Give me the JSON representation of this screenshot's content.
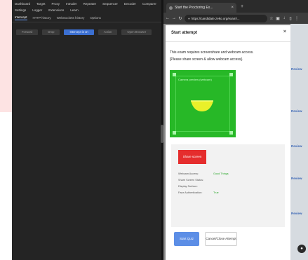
{
  "devtools": {
    "menu": [
      "Dashboard",
      "Target",
      "Proxy",
      "Intruder",
      "Repeater",
      "Sequencer",
      "Decoder",
      "Comparer",
      "Settings",
      "Logger",
      "Extensions",
      "Learn"
    ],
    "tabs": [
      "Intercept",
      "HTTP history",
      "WebSockets history",
      "Options"
    ],
    "toolbar": [
      "Forward",
      "Drop",
      "Intercept is on",
      "Action",
      "Open Browser"
    ],
    "active_tab": 0,
    "active_toolbar": 2
  },
  "browser": {
    "tab_title": "Start the Proctoring Ex...",
    "url": "https://candidate.zeko.org/exam/...",
    "side_links": [
      "Review",
      "Review",
      "Review",
      "Review",
      "Review"
    ]
  },
  "modal": {
    "title": "Start attempt",
    "close_icon": "×",
    "message_line1": "This exam requires screenshare and webcam access.",
    "message_line2": "[Please share screen & allow webcam access].",
    "camera_label": "Camera preview (webcam)",
    "share_button": "Share screen",
    "info": [
      {
        "label": "Webcam Access:",
        "value": "Good Things"
      },
      {
        "label": "Share Screen Status:",
        "value": ""
      },
      {
        "label": "Display Surface:",
        "value": ""
      },
      {
        "label": "Face Authentication:",
        "value": "True"
      }
    ],
    "start_button": "Start Quiz",
    "cancel_button": "Cancel/Close Attempt"
  },
  "colors": {
    "accent": "#5c8ee6",
    "danger": "#e52d2d",
    "camera_green": "#27b827",
    "face_yellow": "#e9f02a"
  }
}
